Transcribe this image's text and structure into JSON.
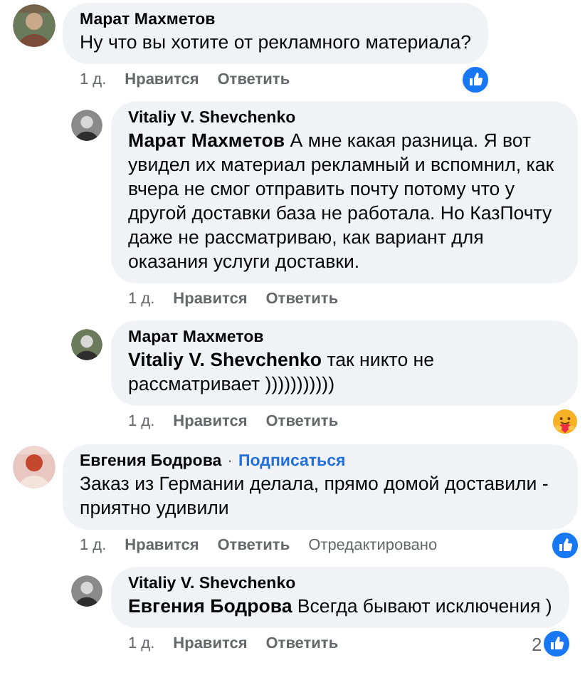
{
  "comments": [
    {
      "author": "Марат Махметов",
      "text": "Ну что вы хотите от рекламного материала?",
      "time": "1 д.",
      "actions": [
        "Нравится",
        "Ответить"
      ],
      "reactions": [
        {
          "kind": "like"
        }
      ],
      "replies": [
        {
          "author": "Vitaliy V. Shevchenko",
          "text": "**Марат Махметов** А мне какая разница. Я вот увидел их материал рекламный и вспомнил, как вчера не смог отправить почту потому что у другой доставки база не работала. Но КазПочту даже не рассматриваю, как вариант для оказания услуги доставки.",
          "time": "1 д.",
          "actions": [
            "Нравится",
            "Ответить"
          ]
        },
        {
          "author": "Марат Махметов",
          "text": "**Vitaliy V. Shevchenko** так никто не рассматривает )))))))))))",
          "time": "1 д.",
          "actions": [
            "Нравится",
            "Ответить"
          ],
          "reactions": [
            {
              "kind": "care"
            }
          ]
        }
      ]
    },
    {
      "author": "Евгения Бодрова",
      "separator": "·",
      "follow": "Подписаться",
      "text": "Заказ из Германии делала, прямо домой доставили - приятно удивили",
      "time": "1 д.",
      "actions": [
        "Нравится",
        "Ответить"
      ],
      "edited": "Отредактировано",
      "reactions": [
        {
          "kind": "like"
        }
      ],
      "replies": [
        {
          "author": "Vitaliy V. Shevchenko",
          "text": "**Евгения Бодрова** Всегда бывают исключения )",
          "time": "1 д.",
          "actions": [
            "Нравится",
            "Ответить"
          ],
          "reactions": [
            {
              "kind": "like",
              "count": "2"
            }
          ]
        }
      ]
    }
  ]
}
